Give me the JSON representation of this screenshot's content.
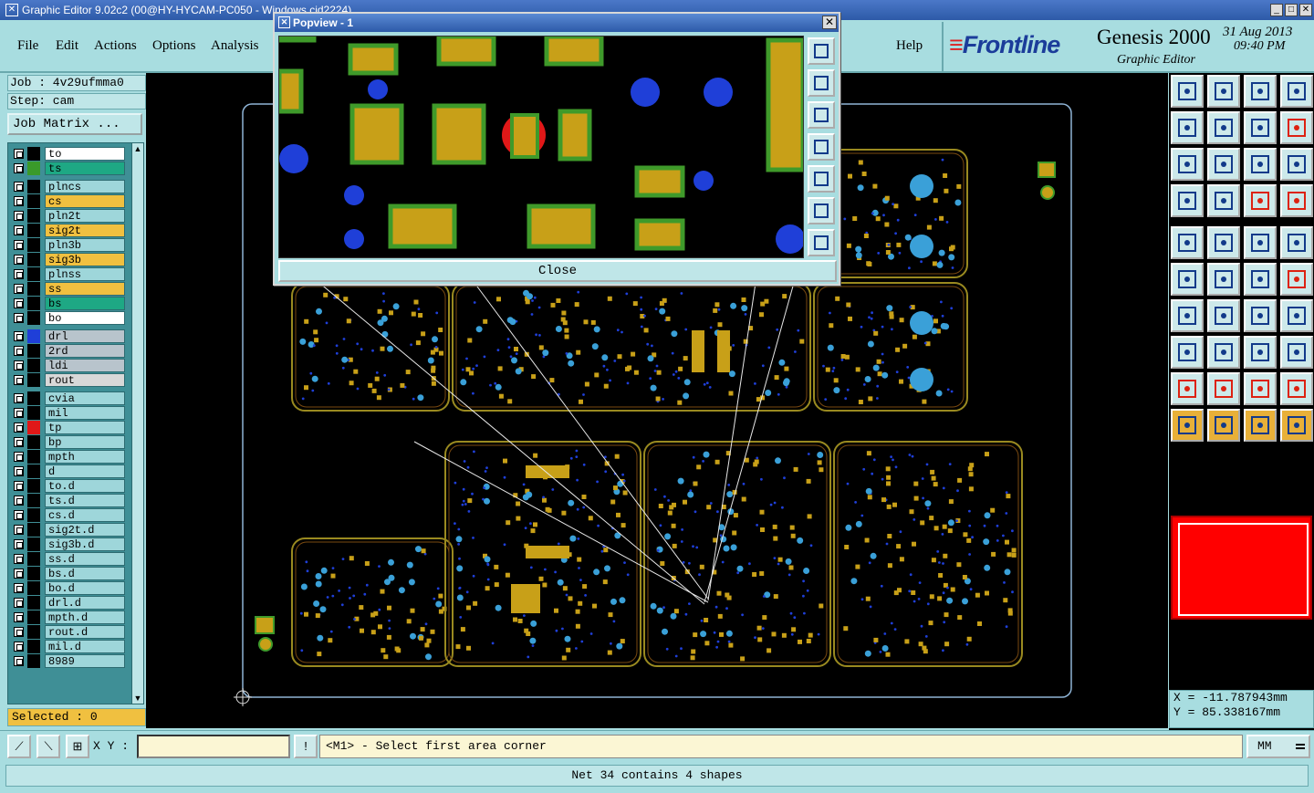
{
  "window": {
    "title": "Graphic Editor 9.02c2 (00@HY-HYCAM-PC050 - Windows cid2224)"
  },
  "menu": {
    "items": [
      "File",
      "Edit",
      "Actions",
      "Options",
      "Analysis"
    ],
    "help": "Help"
  },
  "brand": {
    "logo": "Frontline",
    "product": "Genesis 2000",
    "subtitle": "Graphic Editor",
    "date": "31 Aug 2013",
    "time": "09:40 PM"
  },
  "job": {
    "job_label": "Job : 4v29ufmma0",
    "step_label": "Step: cam",
    "matrix_button": "Job Matrix ..."
  },
  "layers": [
    {
      "name": "to",
      "color": "#ffffff",
      "swatch": "#000000"
    },
    {
      "name": "ts",
      "color": "#1ea884",
      "swatch": "#3a9a2a"
    },
    {
      "name": "plncs",
      "color": "#9ed6da",
      "swatch": "#000000"
    },
    {
      "name": "cs",
      "color": "#f0c040",
      "swatch": "#000000"
    },
    {
      "name": "pln2t",
      "color": "#9ed6da",
      "swatch": "#000000"
    },
    {
      "name": "sig2t",
      "color": "#f0c040",
      "swatch": "#000000"
    },
    {
      "name": "pln3b",
      "color": "#9ed6da",
      "swatch": "#000000"
    },
    {
      "name": "sig3b",
      "color": "#f0c040",
      "swatch": "#000000"
    },
    {
      "name": "plnss",
      "color": "#9ed6da",
      "swatch": "#000000"
    },
    {
      "name": "ss",
      "color": "#f0c040",
      "swatch": "#000000"
    },
    {
      "name": "bs",
      "color": "#1ea884",
      "swatch": "#000000"
    },
    {
      "name": "bo",
      "color": "#ffffff",
      "swatch": "#000000"
    },
    {
      "name": "drl",
      "color": "#b8c4cc",
      "swatch": "#1f3fd8"
    },
    {
      "name": "2rd",
      "color": "#b8c4cc",
      "swatch": "#000000"
    },
    {
      "name": "ldi",
      "color": "#b8c4cc",
      "swatch": "#000000"
    },
    {
      "name": "rout",
      "color": "#d8d8d8",
      "swatch": "#000000"
    },
    {
      "name": "cvia",
      "color": "#9ed6da",
      "swatch": "#000000"
    },
    {
      "name": "mil",
      "color": "#9ed6da",
      "swatch": "#000000"
    },
    {
      "name": "tp",
      "color": "#9ed6da",
      "swatch": "#e01818"
    },
    {
      "name": "bp",
      "color": "#9ed6da",
      "swatch": "#000000"
    },
    {
      "name": "mpth",
      "color": "#9ed6da",
      "swatch": "#000000"
    },
    {
      "name": "d",
      "color": "#9ed6da",
      "swatch": "#000000"
    },
    {
      "name": "to.d",
      "color": "#9ed6da",
      "swatch": "#000000"
    },
    {
      "name": "ts.d",
      "color": "#9ed6da",
      "swatch": "#000000"
    },
    {
      "name": "cs.d",
      "color": "#9ed6da",
      "swatch": "#000000"
    },
    {
      "name": "sig2t.d",
      "color": "#9ed6da",
      "swatch": "#000000"
    },
    {
      "name": "sig3b.d",
      "color": "#9ed6da",
      "swatch": "#000000"
    },
    {
      "name": "ss.d",
      "color": "#9ed6da",
      "swatch": "#000000"
    },
    {
      "name": "bs.d",
      "color": "#9ed6da",
      "swatch": "#000000"
    },
    {
      "name": "bo.d",
      "color": "#9ed6da",
      "swatch": "#000000"
    },
    {
      "name": "drl.d",
      "color": "#9ed6da",
      "swatch": "#000000"
    },
    {
      "name": "mpth.d",
      "color": "#9ed6da",
      "swatch": "#000000"
    },
    {
      "name": "rout.d",
      "color": "#9ed6da",
      "swatch": "#000000"
    },
    {
      "name": "mil.d",
      "color": "#9ed6da",
      "swatch": "#000000"
    },
    {
      "name": "8989",
      "color": "#9ed6da",
      "swatch": "#000000"
    }
  ],
  "selected": "Selected : 0",
  "popview": {
    "title": "Popview - 1",
    "close_label": "Close"
  },
  "coords": {
    "x": "X = -11.787943mm",
    "y": "Y = 85.338167mm"
  },
  "command": {
    "xy_label": "X Y :",
    "xy_value": "",
    "prompt": "<M1> - Select first area corner",
    "units": "MM"
  },
  "status": "Net 34 contains 4 shapes",
  "colors": {
    "pad": "#c8a018",
    "pad_outline": "#3f9a2a",
    "drill": "#1f3fd8",
    "trace": "#9a8a20",
    "highlight": "#e01818",
    "board_outline": "#8fb4d6"
  },
  "toolbar_icons": [
    "zoom-home-icon",
    "zoom-back-icon",
    "zoom-step-icon",
    "zoom-window-icon",
    "pan-left-icon",
    "pan-right-icon",
    "undo-view-icon",
    "redraw-icon",
    "fit-icon",
    "center-icon",
    "one-to-two-icon",
    "help-icon",
    "tools-icon",
    "grid-icon",
    "layers-red-icon",
    "layers-red2-icon",
    "snap-point-icon",
    "measure-icon",
    "ruler-icon",
    "center-snap-icon",
    "net-icon",
    "cross-icon",
    "line-node-icon",
    "line-node-red-icon",
    "add-line-icon",
    "edit-line-icon",
    "arc-icon",
    "split-icon",
    "pad-icon",
    "line-icon",
    "compare-icon",
    "group-icon",
    "tri-red-icon",
    "tri-edit-icon",
    "tri-up-icon",
    "tri-fill-icon",
    "select-icon",
    "select-box-icon",
    "select-rotate-icon",
    "select-net-icon"
  ]
}
